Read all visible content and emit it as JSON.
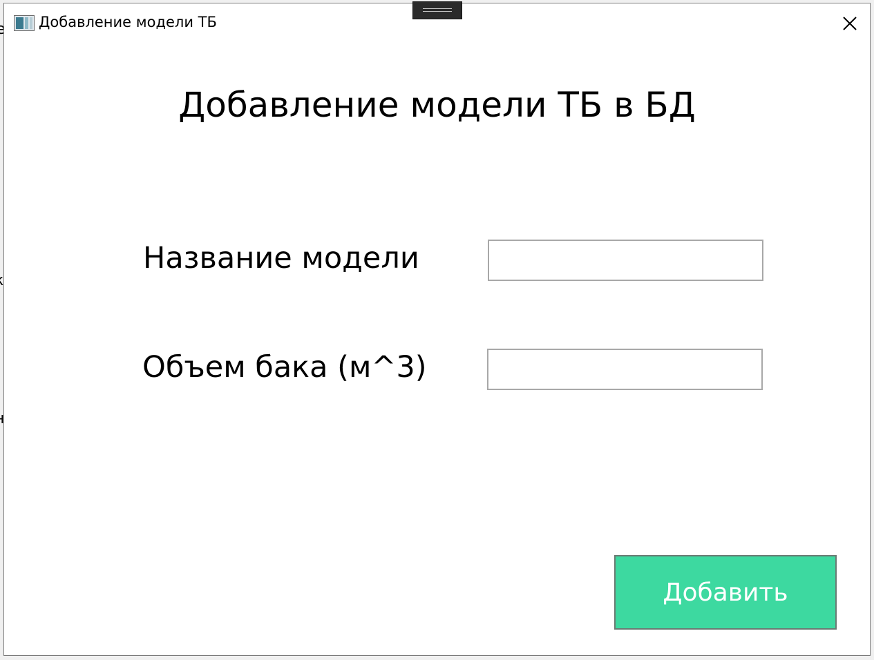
{
  "window": {
    "title": "Добавление модели ТБ",
    "icon": "app-window-icon",
    "close_icon": "close-icon"
  },
  "form": {
    "heading": "Добавление модели ТБ в БД",
    "fields": [
      {
        "label": "Название модели",
        "value": "",
        "placeholder": ""
      },
      {
        "label": "Объем бака (м^3)",
        "value": "",
        "placeholder": ""
      }
    ],
    "submit_label": "Добавить"
  },
  "colors": {
    "accent_button": "#3dd9a0",
    "button_text": "#ffffff",
    "input_border": "#a8a8a8"
  }
}
